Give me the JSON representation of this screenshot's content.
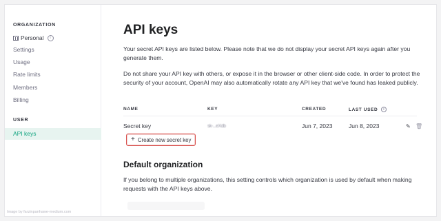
{
  "sidebar": {
    "org_label": "ORGANIZATION",
    "org_items": [
      {
        "label": "Personal",
        "icon": "building-icon"
      },
      {
        "label": "Settings"
      },
      {
        "label": "Usage"
      },
      {
        "label": "Rate limits"
      },
      {
        "label": "Members"
      },
      {
        "label": "Billing"
      }
    ],
    "user_label": "USER",
    "user_items": [
      {
        "label": "API keys",
        "active": true
      }
    ],
    "watermark": "Image by farzinpanhawe-medium.com"
  },
  "main": {
    "title": "API keys",
    "intro": "Your secret API keys are listed below. Please note that we do not display your secret API keys again after you generate them.",
    "warning": "Do not share your API key with others, or expose it in the browser or other client-side code. In order to protect the security of your account, OpenAI may also automatically rotate any API key that we've found has leaked publicly.",
    "table": {
      "columns": [
        "NAME",
        "KEY",
        "CREATED",
        "LAST USED"
      ],
      "rows": [
        {
          "name": "Secret key",
          "key": "sk-...eXdb",
          "created": "Jun 7, 2023",
          "last_used": "Jun 8, 2023"
        }
      ]
    },
    "create_button": "Create new secret key",
    "default_org": {
      "title": "Default organization",
      "description": "If you belong to multiple organizations, this setting controls which organization is used by default when making requests with the API keys above."
    }
  },
  "colors": {
    "accent": "#10a37f",
    "highlight": "#d9534f"
  }
}
